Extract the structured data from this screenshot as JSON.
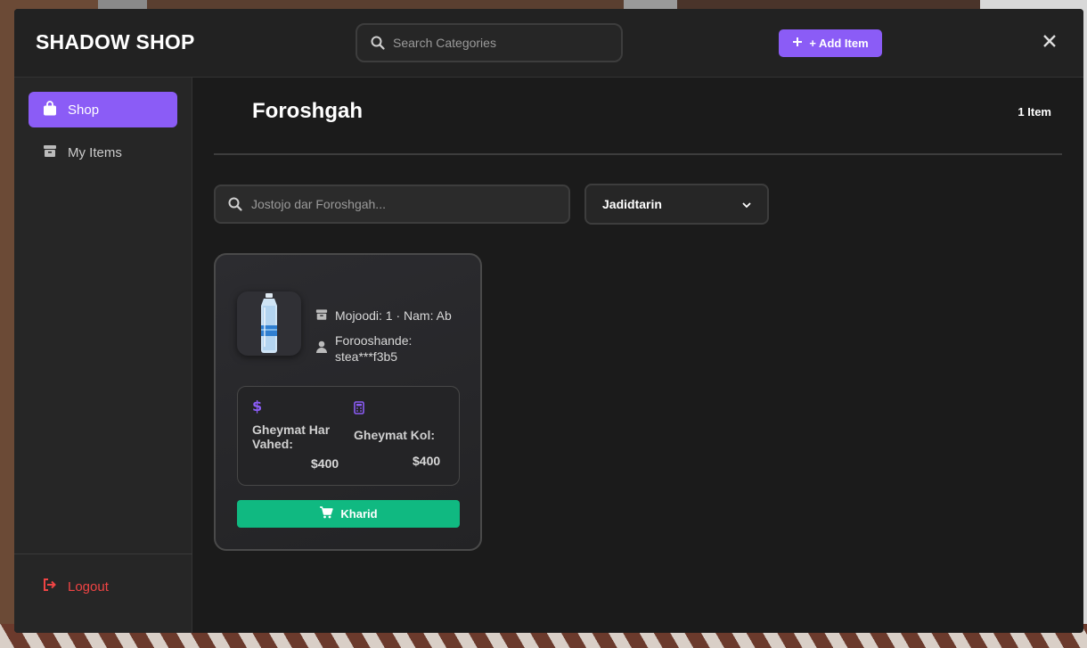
{
  "header": {
    "brand": "SHADOW SHOP",
    "search_placeholder": "Search Categories",
    "add_item_label": "+ Add Item"
  },
  "sidebar": {
    "items": [
      {
        "label": "Shop",
        "icon": "shopping-bag-icon",
        "active": true
      },
      {
        "label": "My Items",
        "icon": "box-icon",
        "active": false
      }
    ],
    "logout_label": "Logout"
  },
  "main": {
    "title": "Foroshgah",
    "item_count": "1 Item",
    "search_placeholder": "Jostojo dar Foroshgah...",
    "sort_selected": "Jadidtarin"
  },
  "products": [
    {
      "image": "water-bottle",
      "stock_line": "Mojoodi: 1 · Nam: Ab",
      "seller_line": "Forooshande: stea***f3b5",
      "unit_price_label": "Gheymat Har Vahed:",
      "unit_price": "$400",
      "total_price_label": "Gheymat Kol:",
      "total_price": "$400",
      "buy_label": "Kharid"
    }
  ],
  "colors": {
    "accent": "#8b5cf6",
    "buy": "#10b981",
    "logout": "#ef4444"
  }
}
